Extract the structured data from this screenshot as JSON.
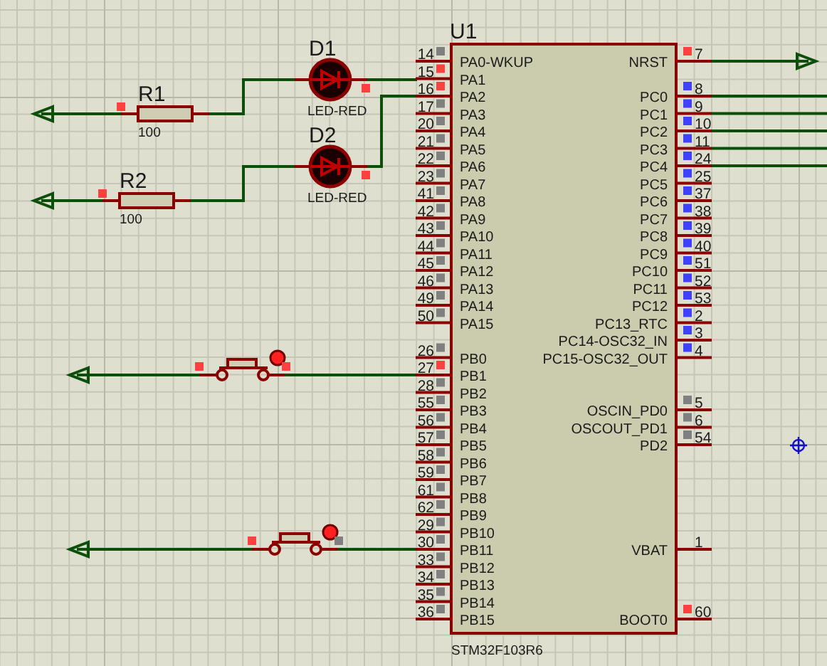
{
  "resistors": [
    {
      "ref": "R1",
      "value": "100"
    },
    {
      "ref": "R2",
      "value": "100"
    }
  ],
  "leds": [
    {
      "ref": "D1",
      "value": "LED-RED"
    },
    {
      "ref": "D2",
      "value": "LED-RED"
    }
  ],
  "buttons": [
    {
      "color": "#ff4040"
    },
    {
      "color": "#808080"
    }
  ],
  "chip": {
    "ref": "U1",
    "part": "STM32F103R6",
    "left_groups": [
      [
        {
          "number": "14",
          "name": "PA0-WKUP",
          "color": "#808080"
        },
        {
          "number": "15",
          "name": "PA1",
          "color": "#ff4040"
        },
        {
          "number": "16",
          "name": "PA2",
          "color": "#ff4040"
        },
        {
          "number": "17",
          "name": "PA3",
          "color": "#808080"
        },
        {
          "number": "20",
          "name": "PA4",
          "color": "#808080"
        },
        {
          "number": "21",
          "name": "PA5",
          "color": "#808080"
        },
        {
          "number": "22",
          "name": "PA6",
          "color": "#808080"
        },
        {
          "number": "23",
          "name": "PA7",
          "color": "#808080"
        },
        {
          "number": "41",
          "name": "PA8",
          "color": "#808080"
        },
        {
          "number": "42",
          "name": "PA9",
          "color": "#808080"
        },
        {
          "number": "43",
          "name": "PA10",
          "color": "#808080"
        },
        {
          "number": "44",
          "name": "PA11",
          "color": "#808080"
        },
        {
          "number": "45",
          "name": "PA12",
          "color": "#808080"
        },
        {
          "number": "46",
          "name": "PA13",
          "color": "#808080"
        },
        {
          "number": "49",
          "name": "PA14",
          "color": "#808080"
        },
        {
          "number": "50",
          "name": "PA15",
          "color": "#808080"
        }
      ],
      [
        {
          "number": "26",
          "name": "PB0",
          "color": "#808080"
        },
        {
          "number": "27",
          "name": "PB1",
          "color": "#ff4040"
        },
        {
          "number": "28",
          "name": "PB2",
          "color": "#808080"
        },
        {
          "number": "55",
          "name": "PB3",
          "color": "#808080"
        },
        {
          "number": "56",
          "name": "PB4",
          "color": "#808080"
        },
        {
          "number": "57",
          "name": "PB5",
          "color": "#808080"
        },
        {
          "number": "58",
          "name": "PB6",
          "color": "#808080"
        },
        {
          "number": "59",
          "name": "PB7",
          "color": "#808080"
        },
        {
          "number": "61",
          "name": "PB8",
          "color": "#808080"
        },
        {
          "number": "62",
          "name": "PB9",
          "color": "#808080"
        },
        {
          "number": "29",
          "name": "PB10",
          "color": "#808080"
        },
        {
          "number": "30",
          "name": "PB11",
          "color": "#808080"
        },
        {
          "number": "33",
          "name": "PB12",
          "color": "#808080"
        },
        {
          "number": "34",
          "name": "PB13",
          "color": "#808080"
        },
        {
          "number": "35",
          "name": "PB14",
          "color": "#808080"
        },
        {
          "number": "36",
          "name": "PB15",
          "color": "#808080"
        }
      ]
    ],
    "right_groups": [
      [
        {
          "number": "7",
          "name": "NRST",
          "color": "#ff4040"
        }
      ],
      [
        {
          "number": "8",
          "name": "PC0",
          "color": "#4040ff"
        },
        {
          "number": "9",
          "name": "PC1",
          "color": "#4040ff"
        },
        {
          "number": "10",
          "name": "PC2",
          "color": "#4040ff"
        },
        {
          "number": "11",
          "name": "PC3",
          "color": "#4040ff"
        },
        {
          "number": "24",
          "name": "PC4",
          "color": "#4040ff"
        },
        {
          "number": "25",
          "name": "PC5",
          "color": "#4040ff"
        },
        {
          "number": "37",
          "name": "PC6",
          "color": "#4040ff"
        },
        {
          "number": "38",
          "name": "PC7",
          "color": "#4040ff"
        },
        {
          "number": "39",
          "name": "PC8",
          "color": "#4040ff"
        },
        {
          "number": "40",
          "name": "PC9",
          "color": "#4040ff"
        },
        {
          "number": "51",
          "name": "PC10",
          "color": "#4040ff"
        },
        {
          "number": "52",
          "name": "PC11",
          "color": "#4040ff"
        },
        {
          "number": "53",
          "name": "PC12",
          "color": "#4040ff"
        },
        {
          "number": "2",
          "name": "PC13_RTC",
          "color": "#4040ff"
        },
        {
          "number": "3",
          "name": "PC14-OSC32_IN",
          "color": "#4040ff"
        },
        {
          "number": "4",
          "name": "PC15-OSC32_OUT",
          "color": "#4040ff"
        }
      ],
      [
        {
          "number": "5",
          "name": "OSCIN_PD0",
          "color": "#808080"
        },
        {
          "number": "6",
          "name": "OSCOUT_PD1",
          "color": "#808080"
        },
        {
          "number": "54",
          "name": "PD2",
          "color": "#808080"
        }
      ],
      [
        {
          "number": "1",
          "name": "VBAT"
        }
      ],
      [
        {
          "number": "60",
          "name": "BOOT0",
          "color": "#ff4040"
        }
      ]
    ]
  }
}
